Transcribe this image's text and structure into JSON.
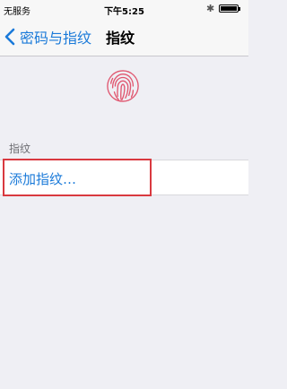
{
  "status_bar": {
    "carrier": "无服务",
    "time": "下午5:25",
    "bluetooth_icon": "bluetooth-icon",
    "battery_icon": "battery-icon"
  },
  "nav": {
    "back_label": "密码与指纹",
    "title": "指纹",
    "back_icon": "chevron-left-icon"
  },
  "fingerprint": {
    "icon": "fingerprint-icon",
    "color": "#e0566f"
  },
  "section": {
    "header": "指纹",
    "add_label": "添加指纹…"
  },
  "colors": {
    "accent": "#1a7ad9",
    "highlight": "#d9393f",
    "background": "#efeff4"
  }
}
